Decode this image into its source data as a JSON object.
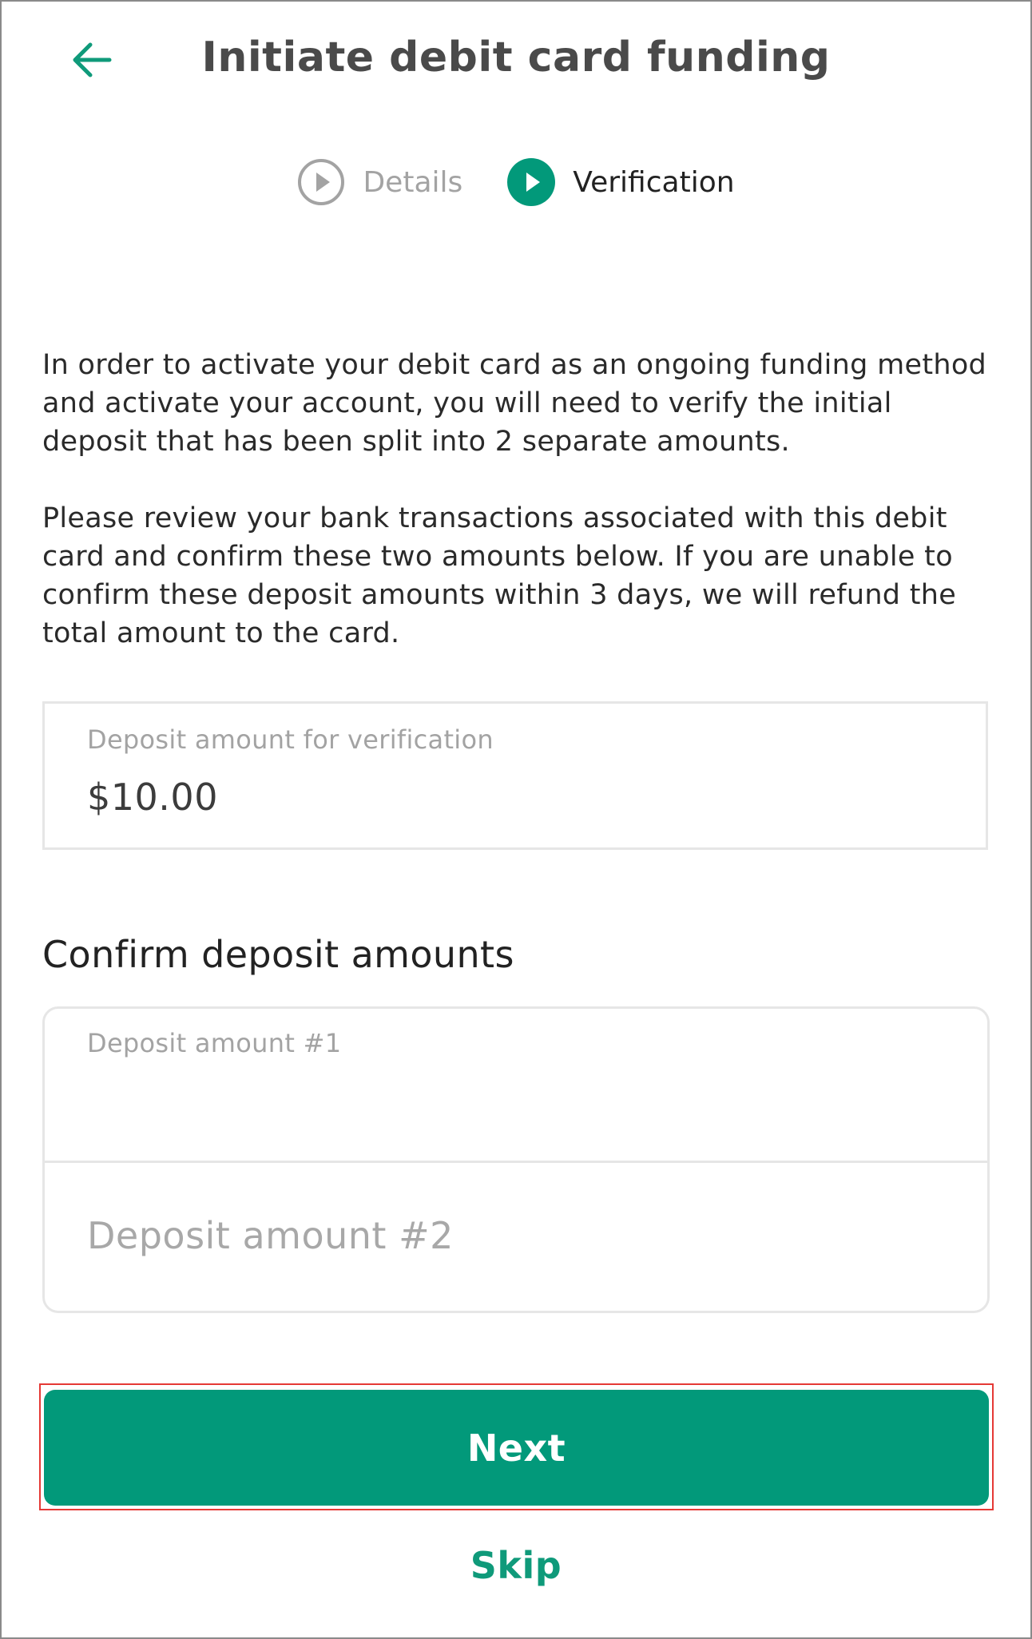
{
  "header": {
    "title": "Initiate debit card funding",
    "back_icon": "arrow-left-icon"
  },
  "stepper": {
    "steps": [
      {
        "label": "Details",
        "state": "inactive",
        "icon": "play-circle-outline-icon"
      },
      {
        "label": "Verification",
        "state": "active",
        "icon": "play-circle-filled-icon"
      }
    ]
  },
  "intro": {
    "paragraph1": "In order to activate your debit card as an ongoing funding method and activate your account, you will need to verify the initial deposit that has been split into 2 separate amounts.",
    "paragraph2": "Please review your bank transactions associated with this debit card and confirm these two amounts below.  If you are unable to confirm these deposit amounts within 3 days, we will refund the total amount to the card."
  },
  "verification_deposit": {
    "label": "Deposit amount for verification",
    "value": "$10.00"
  },
  "confirm_section": {
    "title": "Confirm deposit amounts",
    "amount1": {
      "label": "Deposit amount #1",
      "value": ""
    },
    "amount2": {
      "placeholder": "Deposit amount #2",
      "value": ""
    }
  },
  "actions": {
    "next_label": "Next",
    "skip_label": "Skip"
  },
  "colors": {
    "brand_green": "#02997a",
    "link_green": "#0f9a7a",
    "muted_gray": "#a3a3a3",
    "highlight_red": "#e53935"
  }
}
